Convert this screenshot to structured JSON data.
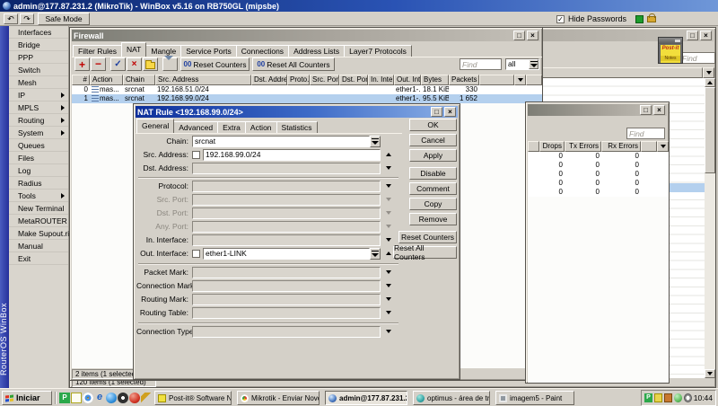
{
  "app": {
    "title": "admin@177.87.231.2 (MikroTik) - WinBox v5.16 on RB750GL (mipsbe)",
    "safe_mode": "Safe Mode",
    "hide_passwords": "Hide Passwords",
    "brand_vertical": "RouterOS WinBox"
  },
  "sidebar": {
    "items": [
      {
        "label": "Interfaces"
      },
      {
        "label": "Bridge"
      },
      {
        "label": "PPP"
      },
      {
        "label": "Switch"
      },
      {
        "label": "Mesh"
      },
      {
        "label": "IP",
        "submenu": true
      },
      {
        "label": "MPLS",
        "submenu": true
      },
      {
        "label": "Routing",
        "submenu": true
      },
      {
        "label": "System",
        "submenu": true
      },
      {
        "label": "Queues"
      },
      {
        "label": "Files"
      },
      {
        "label": "Log"
      },
      {
        "label": "Radius"
      },
      {
        "label": "Tools",
        "submenu": true
      },
      {
        "label": "New Terminal"
      },
      {
        "label": "MetaROUTER"
      },
      {
        "label": "Make Supout.rif"
      },
      {
        "label": "Manual"
      },
      {
        "label": "Exit"
      }
    ]
  },
  "firewall": {
    "title": "Firewall",
    "tabs": [
      "Filter Rules",
      "NAT",
      "Mangle",
      "Service Ports",
      "Connections",
      "Address Lists",
      "Layer7 Protocols"
    ],
    "active_tab": "NAT",
    "toolbar": {
      "counter_icon": "00",
      "reset_counters": "Reset Counters",
      "reset_all_counters": "Reset All Counters",
      "find_placeholder": "Find",
      "filter_value": "all"
    },
    "columns": {
      "num": "#",
      "action": "Action",
      "chain": "Chain",
      "src_address": "Src. Address",
      "dst_address": "Dst. Address",
      "proto": "Proto...",
      "src_port": "Src. Port",
      "dst_port": "Dst. Port",
      "in_interface": "In. Inter...",
      "out_interface": "Out. Int...",
      "bytes": "Bytes",
      "packets": "Packets"
    },
    "rows": [
      {
        "num": "0",
        "action": "mas...",
        "chain": "srcnat",
        "src_address": "192.168.51.0/24",
        "out_interface": "ether1-...",
        "bytes": "18.1 KiB",
        "packets": "330"
      },
      {
        "num": "1",
        "action": "mas...",
        "chain": "srcnat",
        "src_address": "192.168.99.0/24",
        "out_interface": "ether1-...",
        "bytes": "95.5 KiB",
        "packets": "1 652"
      }
    ],
    "status": "2 items (1 selected)"
  },
  "nat_dialog": {
    "title": "NAT Rule <192.168.99.0/24>",
    "tabs": [
      "General",
      "Advanced",
      "Extra",
      "Action",
      "Statistics"
    ],
    "active_tab": "General",
    "fields": {
      "chain": {
        "label": "Chain:",
        "value": "srcnat"
      },
      "src_address": {
        "label": "Src. Address:",
        "value": "192.168.99.0/24"
      },
      "dst_address": {
        "label": "Dst. Address:"
      },
      "protocol": {
        "label": "Protocol:"
      },
      "src_port": {
        "label": "Src. Port:"
      },
      "dst_port": {
        "label": "Dst. Port:"
      },
      "any_port": {
        "label": "Any. Port:"
      },
      "in_interface": {
        "label": "In. Interface:"
      },
      "out_interface": {
        "label": "Out. Interface:",
        "value": "ether1-LINK"
      },
      "packet_mark": {
        "label": "Packet Mark:"
      },
      "connection_mark": {
        "label": "Connection Mark:"
      },
      "routing_mark": {
        "label": "Routing Mark:"
      },
      "routing_table": {
        "label": "Routing Table:"
      },
      "connection_type": {
        "label": "Connection Type:"
      }
    },
    "buttons": [
      "OK",
      "Cancel",
      "Apply",
      "Disable",
      "Comment",
      "Copy",
      "Remove",
      "Reset Counters",
      "Reset All Counters"
    ]
  },
  "stats_window": {
    "find_placeholder": "Find",
    "columns": [
      "Drops",
      "Tx Errors",
      "Rx Errors"
    ],
    "rows": [
      [
        "0",
        "0",
        "0"
      ],
      [
        "0",
        "0",
        "0"
      ],
      [
        "0",
        "0",
        "0"
      ],
      [
        "0",
        "0",
        "0"
      ],
      [
        "0",
        "0",
        "0"
      ]
    ]
  },
  "background_window": {
    "find_placeholder": "Find",
    "status": "120 items (1 selected)"
  },
  "post_it_note": {
    "line1": "Post-it",
    "line2": "Notes"
  },
  "taskbar": {
    "start": "Iniciar",
    "windows": [
      {
        "label": "Post-it® Software Notes"
      },
      {
        "label": "Mikrotik - Enviar Novo Tó..."
      },
      {
        "label": "admin@177.87.231.2 ...",
        "active": true
      },
      {
        "label": "optimus - área de trabal..."
      },
      {
        "label": "imagem5 - Paint"
      }
    ],
    "clock": "10:44"
  },
  "colors": {
    "active_titlebar": "#0d2f9b",
    "inactive_titlebar": "#7d7d75",
    "selection": "#b4d0ee",
    "chrome": "#d4d0c8",
    "brand_blue": "#25309a"
  }
}
